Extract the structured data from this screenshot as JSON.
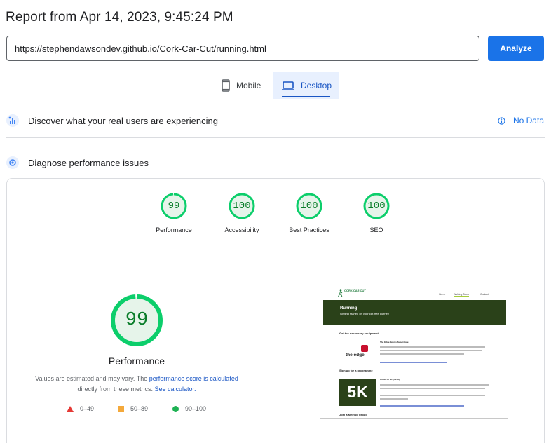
{
  "report": {
    "title": "Report from Apr 14, 2023, 9:45:24 PM"
  },
  "url_bar": {
    "value": "https://stephendawsondev.github.io/Cork-Car-Cut/running.html",
    "analyze_label": "Analyze"
  },
  "device_tabs": [
    {
      "label": "Mobile",
      "icon": "smartphone-icon",
      "selected": false
    },
    {
      "label": "Desktop",
      "icon": "laptop-icon",
      "selected": true
    }
  ],
  "discover": {
    "title": "Discover what your real users are experiencing",
    "no_data_label": "No Data"
  },
  "diagnose": {
    "title": "Diagnose performance issues"
  },
  "scores": [
    {
      "label": "Performance",
      "value": "99",
      "fraction": 0.99
    },
    {
      "label": "Accessibility",
      "value": "100",
      "fraction": 1.0
    },
    {
      "label": "Best Practices",
      "value": "100",
      "fraction": 1.0
    },
    {
      "label": "SEO",
      "value": "100",
      "fraction": 1.0
    }
  ],
  "performance_detail": {
    "score": "99",
    "fraction": 0.99,
    "title": "Performance",
    "desc_prefix": "Values are estimated and may vary. The ",
    "desc_link1": "performance score is calculated",
    "desc_middle": " directly from these metrics. ",
    "desc_link2": "See calculator.",
    "legend": [
      {
        "range": "0–49",
        "color": "#e53935",
        "shape": "triangle"
      },
      {
        "range": "50–89",
        "color": "#f4a93b",
        "shape": "square"
      },
      {
        "range": "90–100",
        "color": "#1fb254",
        "shape": "circle"
      }
    ]
  },
  "colors": {
    "accent": "#1a73e8",
    "pass": "#0cce6b",
    "pass_text": "#0a7d2a",
    "pass_fill": "#e6f4ea"
  },
  "screenshot": {
    "logo_text": "CORK CAR CUT",
    "nav": [
      "Home",
      "Walking Tours",
      "Contact"
    ],
    "hero_title": "Running",
    "hero_subtitle": "Getting started on your car-free journey",
    "section1": "Get the necessary equipment",
    "card1_title": "The Edge Sports Superstore",
    "edge_logo_text": "the edge",
    "section2": "Sign up for a programme",
    "card2_title": "Couch to 5K (C25K)",
    "badge": "5K",
    "section3": "Join a Meetup Group"
  }
}
